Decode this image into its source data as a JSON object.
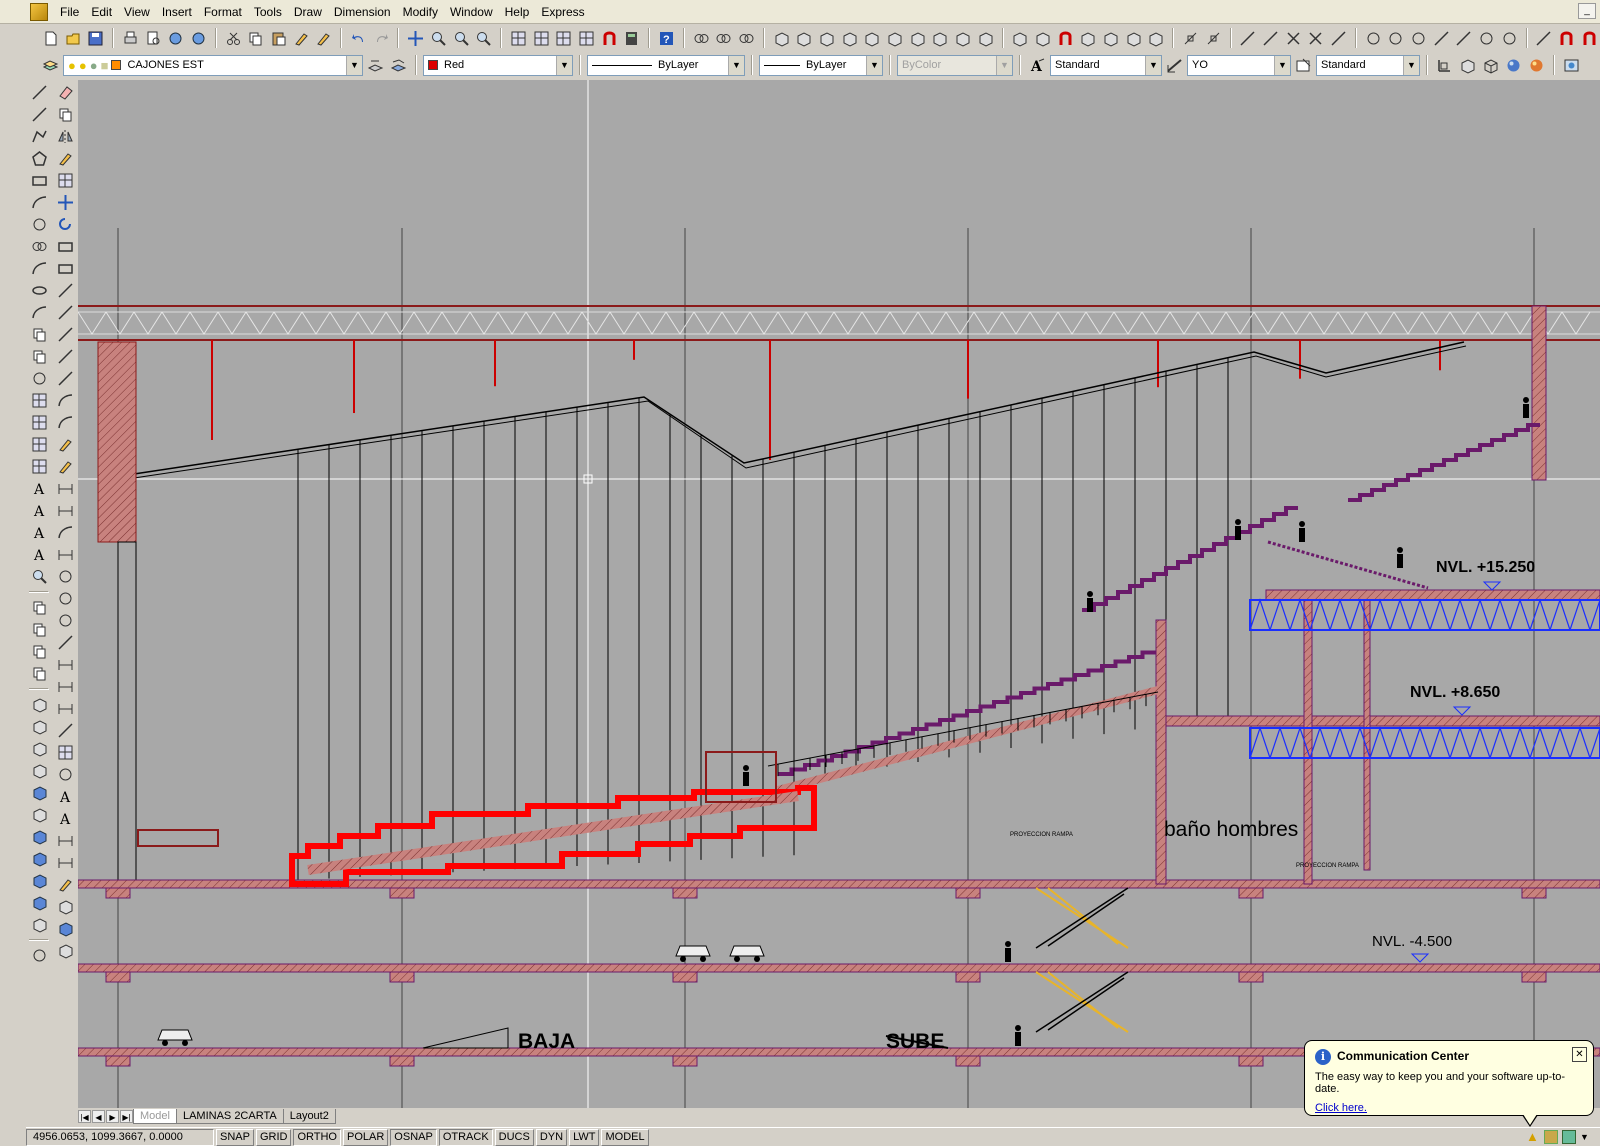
{
  "menu": [
    "File",
    "Edit",
    "View",
    "Insert",
    "Format",
    "Tools",
    "Draw",
    "Dimension",
    "Modify",
    "Window",
    "Help",
    "Express"
  ],
  "properties": {
    "layer": "CAJONES EST",
    "color": "Red",
    "color_hex": "#dd0000",
    "linetype": "ByLayer",
    "lineweight": "ByLayer",
    "plotstyle": "ByColor",
    "text_style": "Standard",
    "dim_style": "YO",
    "table_style": "Standard"
  },
  "drawing": {
    "labels": {
      "nvl_top": "NVL. +15.250",
      "nvl_mid": "NVL. +8.650",
      "nvl_low": "NVL. -4.500",
      "bano": "baño hombres",
      "baja": "BAJA",
      "sube": "SUBE",
      "proyeccion1": "PROYECCION RAMPA",
      "proyeccion2": "PROYECCION RAMPA"
    },
    "colors": {
      "background": "#a8a8a8",
      "slab_fill": "#c8827e",
      "highlight": "#ff0000",
      "truss_blue": "#1a2eff",
      "stair_yellow": "#e8b42a"
    }
  },
  "tabs": [
    "Model",
    "LAMINAS 2CARTA",
    "Layout2"
  ],
  "status": {
    "coords": "4956.0653, 1099.3667, 0.0000",
    "buttons": [
      "SNAP",
      "GRID",
      "ORTHO",
      "POLAR",
      "OSNAP",
      "OTRACK",
      "DUCS",
      "DYN",
      "LWT",
      "MODEL"
    ]
  },
  "balloon": {
    "title": "Communication Center",
    "message": "The easy way to keep you and your software up-to-date.",
    "link": "Click here."
  }
}
